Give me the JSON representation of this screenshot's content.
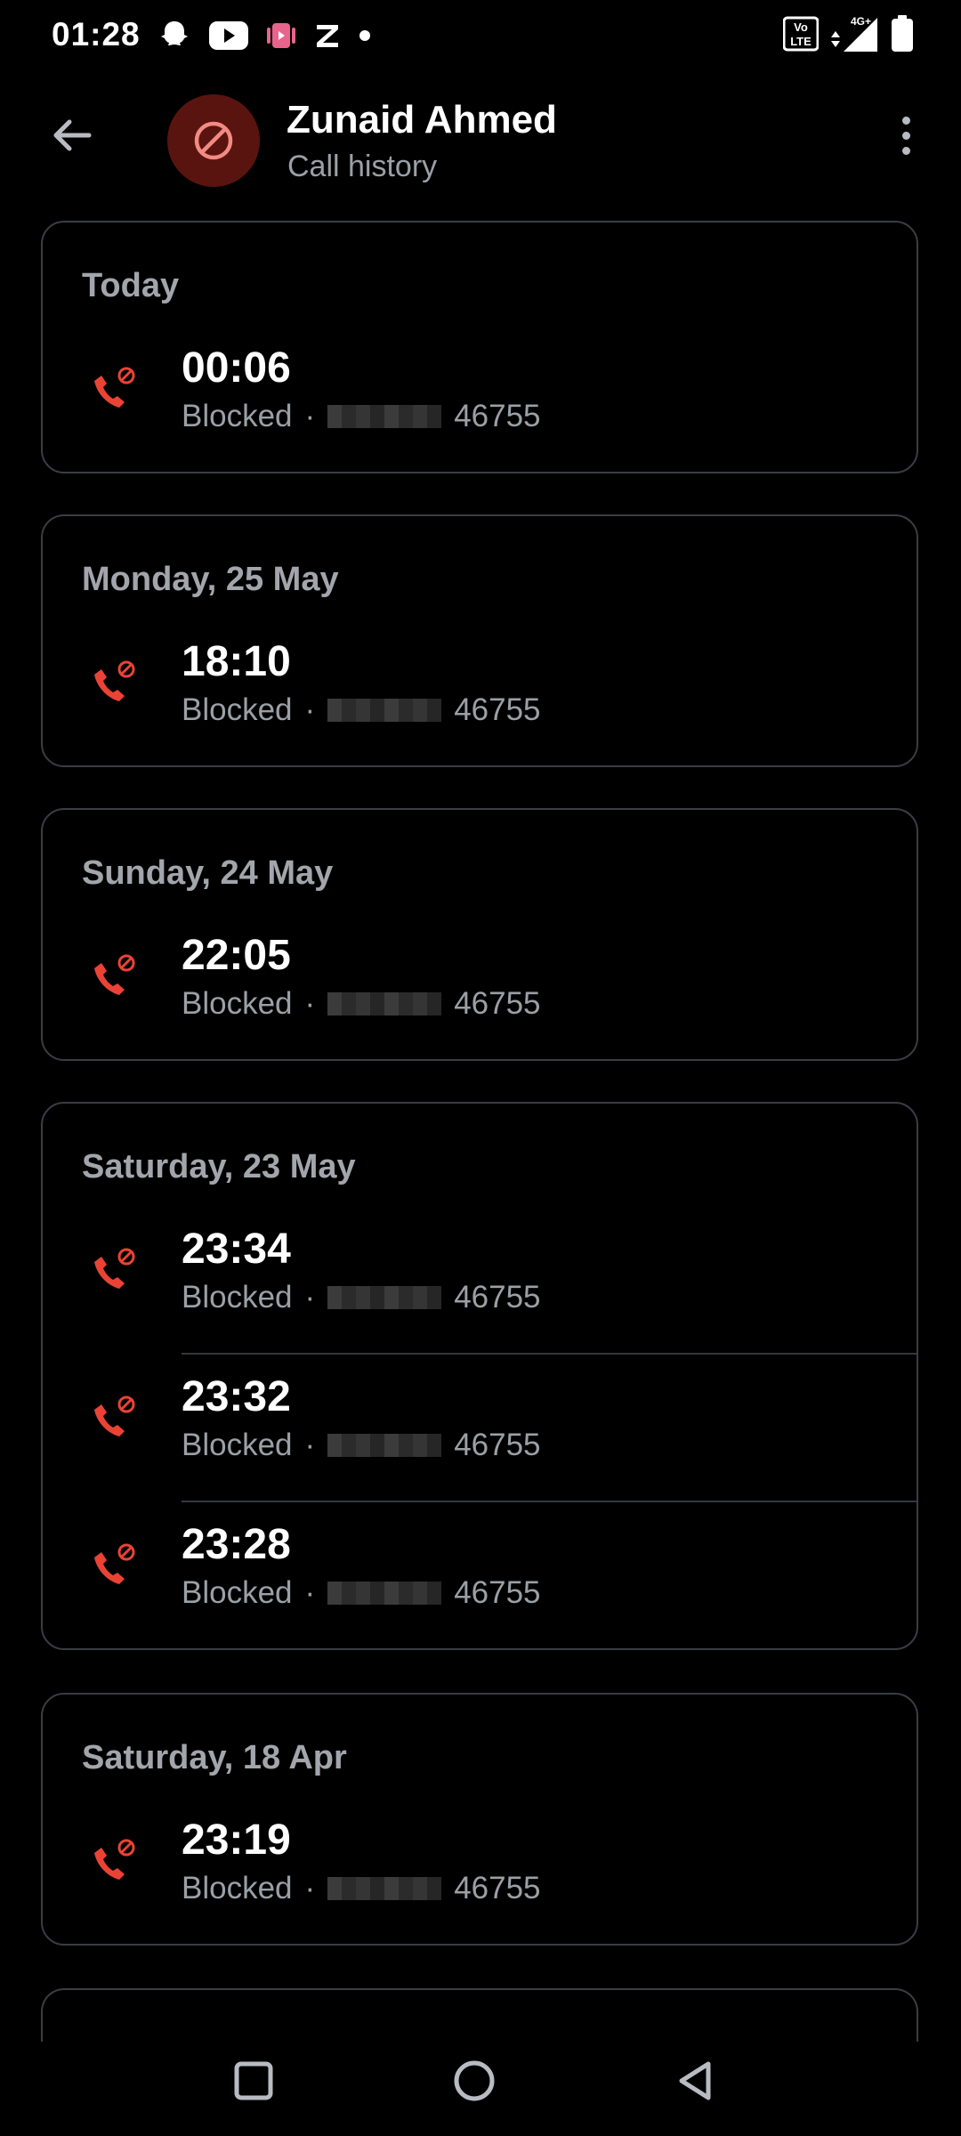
{
  "status": {
    "time": "01:28",
    "icons": [
      "snapchat-icon",
      "youtube-icon",
      "app-icon",
      "z-icon",
      "dot-icon"
    ],
    "network": "4G+",
    "volte": "Vo LTE"
  },
  "header": {
    "name": "Zunaid Ahmed",
    "subtitle": "Call history",
    "accent": "#5a1410"
  },
  "groups": [
    {
      "date": "Today",
      "entries": [
        {
          "time": "00:06",
          "status": "Blocked",
          "sep": "·",
          "number_suffix": "46755"
        }
      ]
    },
    {
      "date": "Monday, 25 May",
      "entries": [
        {
          "time": "18:10",
          "status": "Blocked",
          "sep": "·",
          "number_suffix": "46755"
        }
      ]
    },
    {
      "date": "Sunday, 24 May",
      "entries": [
        {
          "time": "22:05",
          "status": "Blocked",
          "sep": "·",
          "number_suffix": "46755"
        }
      ]
    },
    {
      "date": "Saturday, 23 May",
      "entries": [
        {
          "time": "23:34",
          "status": "Blocked",
          "sep": "·",
          "number_suffix": "46755"
        },
        {
          "time": "23:32",
          "status": "Blocked",
          "sep": "·",
          "number_suffix": "46755"
        },
        {
          "time": "23:28",
          "status": "Blocked",
          "sep": "·",
          "number_suffix": "46755"
        }
      ]
    },
    {
      "date": "Saturday, 18 Apr",
      "entries": [
        {
          "time": "23:19",
          "status": "Blocked",
          "sep": "·",
          "number_suffix": "46755"
        }
      ]
    }
  ],
  "colors": {
    "blocked_icon": "#ea4335",
    "muted_text": "#9aa0a6"
  }
}
